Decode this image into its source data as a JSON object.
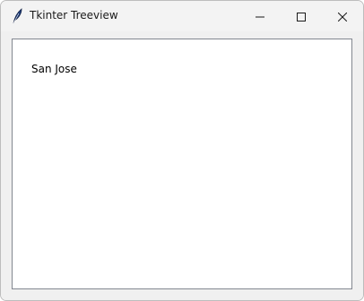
{
  "window": {
    "title": "Tkinter Treeview",
    "app_icon": "feather-icon",
    "controls": {
      "minimize_icon": "minimize-icon",
      "maximize_icon": "maximize-icon",
      "close_icon": "close-icon"
    }
  },
  "treeview": {
    "items": [
      {
        "label": "San Jose"
      }
    ]
  },
  "colors": {
    "window_bg": "#f0f0f0",
    "titlebar_bg": "#f3f3f3",
    "tree_bg": "#ffffff",
    "tree_border": "#828790"
  }
}
